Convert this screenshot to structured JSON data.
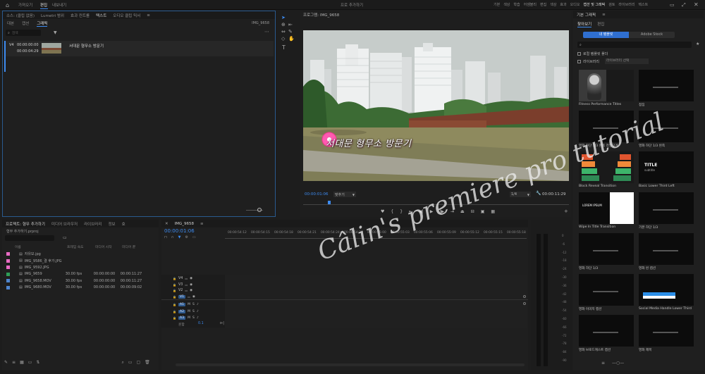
{
  "topbar": {
    "menu": [
      "가져오기",
      "편집",
      "내보내기"
    ],
    "active_index": 1,
    "title": "프로 추가하기",
    "workspaces": [
      "기본",
      "색상",
      "학습",
      "어셈블리",
      "편집",
      "색상",
      "효과",
      "오디오",
      "캡션 및 그래픽",
      "검토",
      "라이브러리",
      "텍스트"
    ],
    "workspace_active_index": 8
  },
  "text_panel": {
    "tabs": [
      "소스: (클립 없음)",
      "Lumetri 범위",
      "효과 컨트롤",
      "텍스트",
      "오디오 클립 믹서"
    ],
    "active_tab": 3,
    "subtabs": [
      "대본",
      "캡션",
      "그래픽"
    ],
    "active_subtab": 2,
    "clip_name": "IMG_9658",
    "search_placeholder": "검색",
    "item": {
      "track": "V4",
      "time_in": "00:00:00:00",
      "time_out": "00:00:04:29",
      "label": "서대문 형무소 방문기"
    }
  },
  "program": {
    "title": "프로그램: IMG_9658",
    "timecode": "00:00:01:06",
    "fit": "맞추기",
    "quality": "1/4",
    "duration": "00:00:11:29",
    "overlay_text": "서대문 형무소 방문기",
    "watermark": "Câlin's premiere pro tutorial"
  },
  "project": {
    "tabs": [
      "프로젝트: 형무 추가하기",
      "미디어 브라우저",
      "라이브러리",
      "정보",
      "효"
    ],
    "filename": "형무 추가하기.prproj",
    "headers": [
      "이름",
      "프레임 속도",
      "미디어 시작",
      "미디어 끝"
    ],
    "files": [
      {
        "name": "자유모.jpg",
        "fps": "",
        "start": "",
        "end": "",
        "color": "#e86bc4"
      },
      {
        "name": "IMG_9586_결 후가.JPG",
        "fps": "",
        "start": "",
        "end": "",
        "color": "#e86bc4"
      },
      {
        "name": "IMG_9592.JPG",
        "fps": "",
        "start": "",
        "end": "",
        "color": "#e86bc4"
      },
      {
        "name": "IMG_9659",
        "fps": "30.00 fps",
        "start": "00:00:00:00",
        "end": "00:00:11:27",
        "color": "#2e9e58"
      },
      {
        "name": "IMG_9658.MOV",
        "fps": "30.00 fps",
        "start": "00:00:00:00",
        "end": "00:00:11:27",
        "color": "#4f86cf"
      },
      {
        "name": "IMG_9680.MOV",
        "fps": "30.00 fps",
        "start": "00:00:00:00",
        "end": "00:00:09:02",
        "color": "#4f86cf"
      }
    ]
  },
  "timeline": {
    "tab": "IMG_9658",
    "timecode": "00:00:01:06",
    "ruler": [
      "00:00:54:12",
      "00:00:54:15",
      "00:00:54:18",
      "00:00:54:21",
      "00:00:54:24",
      "00:00:54:27",
      "00:00:55:00",
      "00:00:55:03",
      "00:00:55:06",
      "00:00:55:09",
      "00:00:55:12",
      "00:00:55:15",
      "00:00:55:18"
    ],
    "video_tracks": [
      "V4",
      "V3",
      "V2",
      "V1"
    ],
    "audio_tracks": [
      "A1",
      "A2",
      "A3"
    ],
    "mix_label": "혼합",
    "mix_value": "0.1"
  },
  "meter": {
    "ticks": [
      "0",
      "-6",
      "-12",
      "-18",
      "-24",
      "-30",
      "-36",
      "-42",
      "-48",
      "-54",
      "-60",
      "-66",
      "-72",
      "-78",
      "-84",
      "-90"
    ]
  },
  "essential": {
    "title": "기본 그래픽",
    "tabs": [
      "찾아보기",
      "편집"
    ],
    "active_tab": 0,
    "segments": [
      "내 템플릿",
      "Adobe Stock"
    ],
    "checkbox1": "로컬 템플릿 폴더",
    "checkbox2": "라이브러리",
    "lib_select": "라이브러리 선택",
    "templates": [
      {
        "label": "Fitness Performance Titles",
        "kind": "woman"
      },
      {
        "label": "점짐",
        "kind": "dark"
      },
      {
        "label": "영화 하단 1/3 왼쪽 라인 2개",
        "kind": "dark"
      },
      {
        "label": "영화 하단 1/3 왼쪽",
        "kind": "dark"
      },
      {
        "label": "Block Reveal Transition",
        "kind": "blocks"
      },
      {
        "label": "Basic Lower Third Left",
        "kind": "title",
        "title": "TITLE",
        "sub": "subtitle"
      },
      {
        "label": "Wipe In Title Transition",
        "kind": "wipe",
        "title": "LOREM IPSUM"
      },
      {
        "label": "기본 하단 1/3",
        "kind": "dark2"
      },
      {
        "label": "영화 하단 1/3",
        "kind": "dark"
      },
      {
        "label": "영화 왼 캡션",
        "kind": "dark"
      },
      {
        "label": "영화 이미지 캡션",
        "kind": "dark"
      },
      {
        "label": "Social Media Handle Lower Third",
        "kind": "social"
      },
      {
        "label": "영화 브로드캐스트 캡션",
        "kind": "dark"
      },
      {
        "label": "영화 제목",
        "kind": "dark3"
      }
    ]
  }
}
